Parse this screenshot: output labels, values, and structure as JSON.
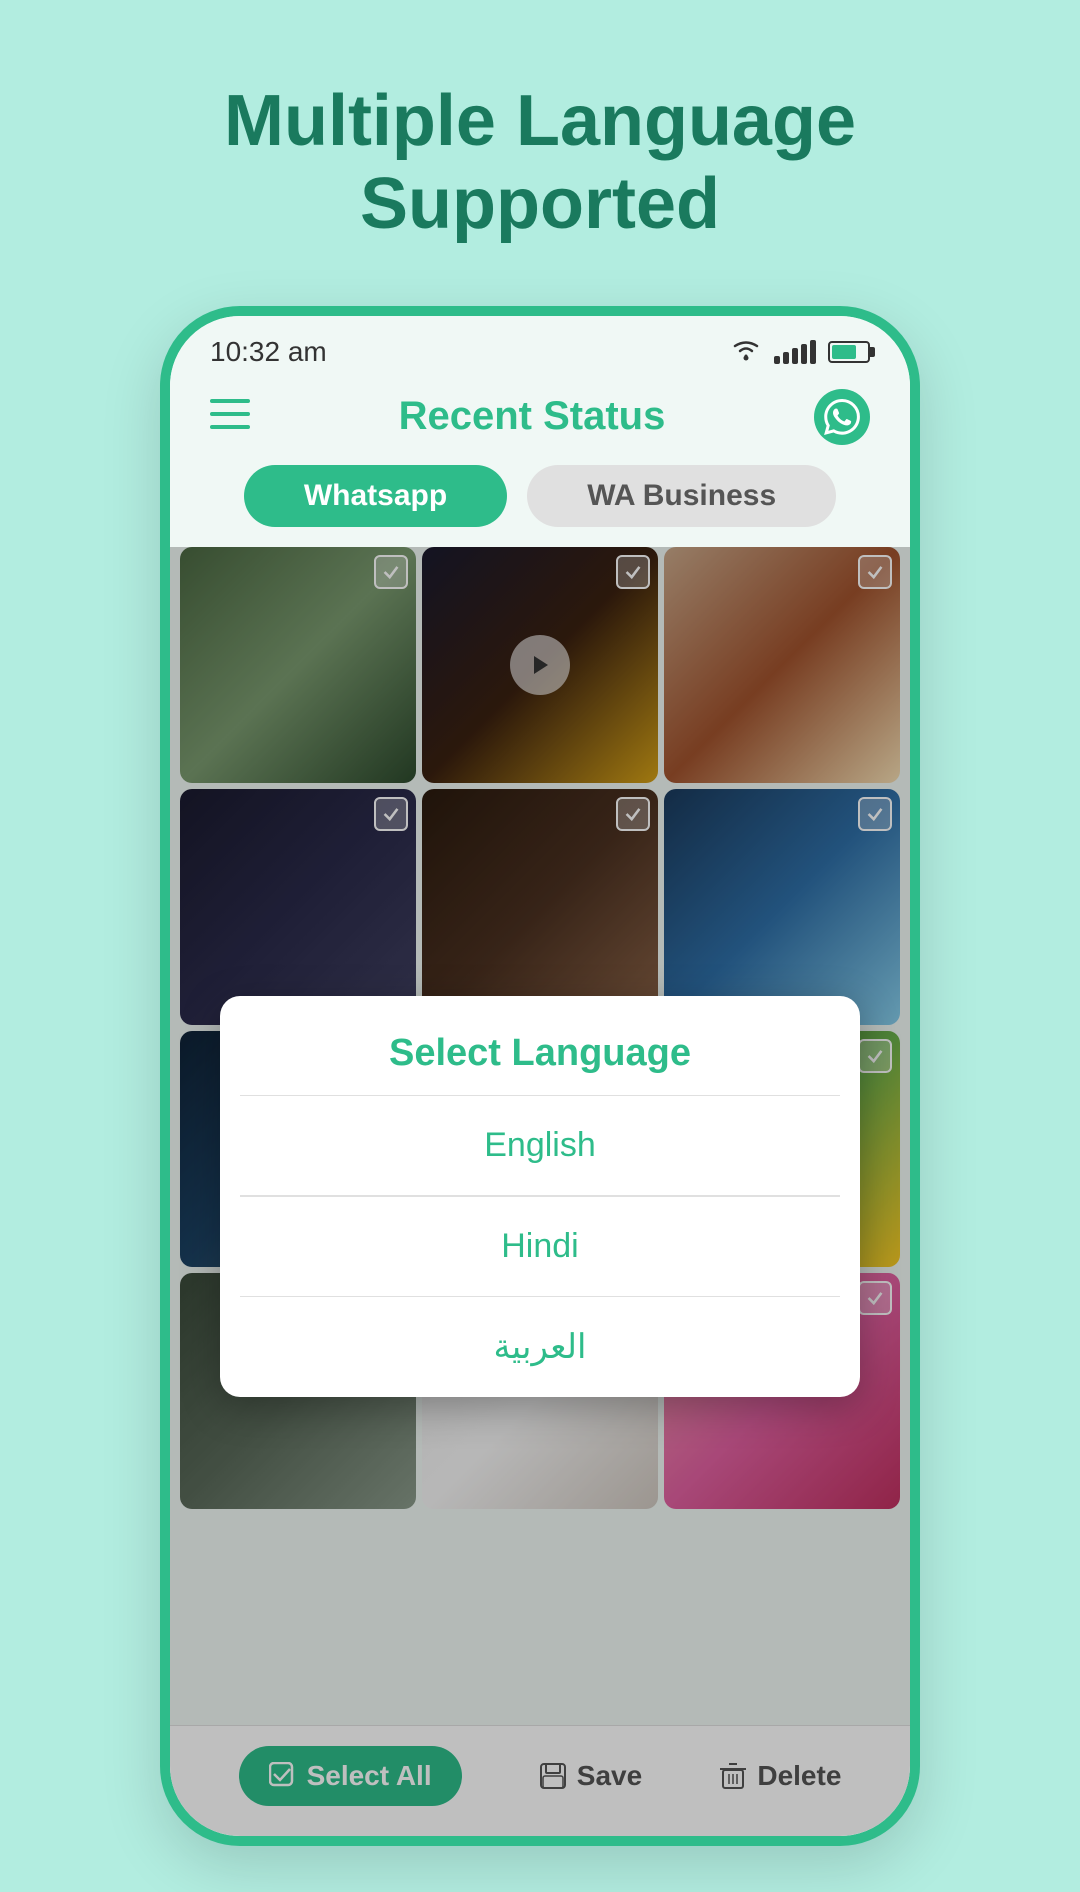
{
  "page": {
    "headline_line1": "Multiple Language",
    "headline_line2": "Supported",
    "bg_color": "#b2ede0",
    "accent_color": "#2ebc8a"
  },
  "status_bar": {
    "time": "10:32 am"
  },
  "header": {
    "title": "Recent Status"
  },
  "tabs": {
    "active": "Whatsapp",
    "inactive": "WA Business"
  },
  "modal": {
    "title": "Select Language",
    "options": [
      {
        "label": "English"
      },
      {
        "label": "Hindi"
      },
      {
        "label": "العربية"
      }
    ]
  },
  "bottom_bar": {
    "select_all": "Select All",
    "save": "Save",
    "delete": "Delete"
  }
}
